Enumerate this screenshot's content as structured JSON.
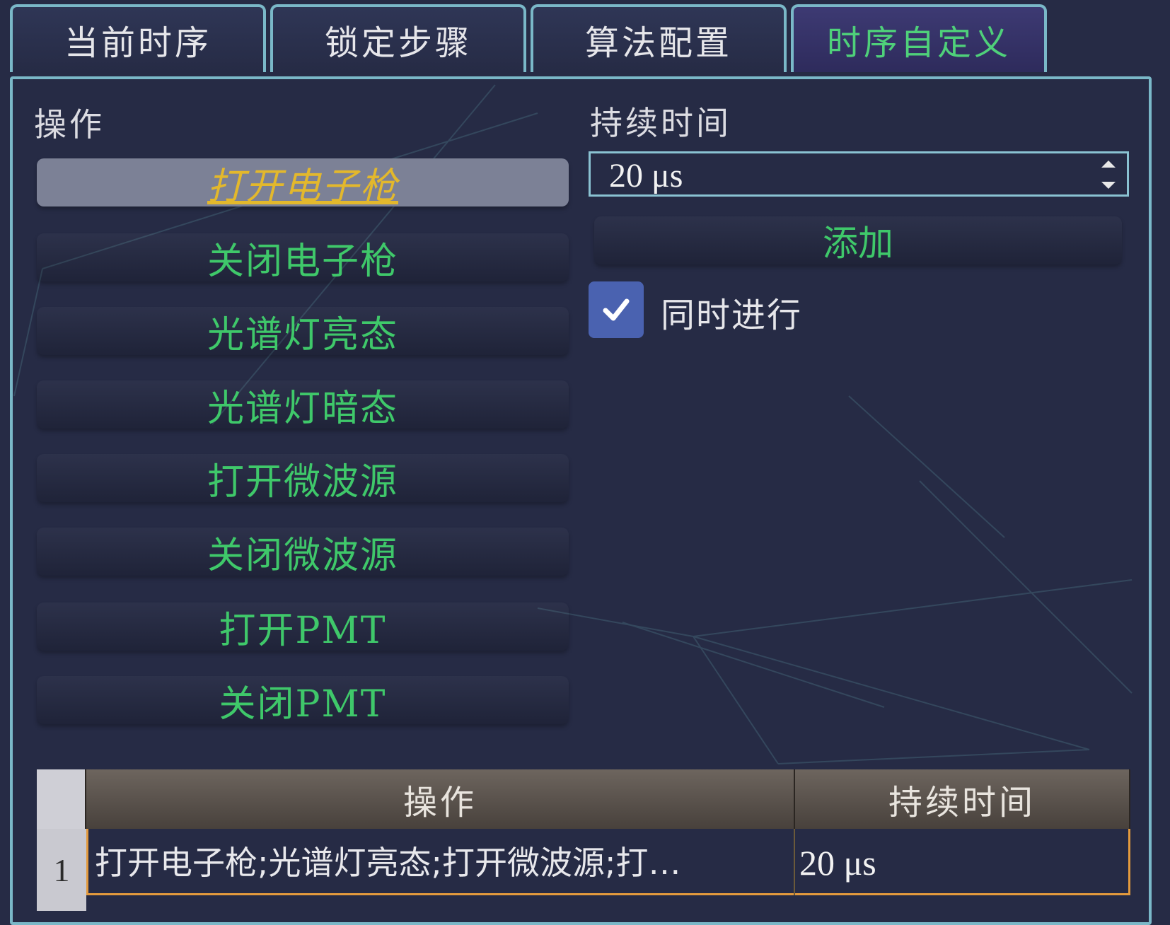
{
  "tabs": [
    {
      "label": "当前时序",
      "active": false
    },
    {
      "label": "锁定步骤",
      "active": false
    },
    {
      "label": "算法配置",
      "active": false
    },
    {
      "label": "时序自定义",
      "active": true
    }
  ],
  "operations": {
    "label": "操作",
    "items": [
      "打开电子枪",
      "关闭电子枪",
      "光谱灯亮态",
      "光谱灯暗态",
      "打开微波源",
      "关闭微波源",
      "打开PMT",
      "关闭PMT"
    ],
    "selected_index": 0
  },
  "duration": {
    "label": "持续时间",
    "value": "20 μs"
  },
  "add_button": {
    "label": "添加"
  },
  "simultaneous": {
    "label": "同时进行",
    "checked": true
  },
  "table": {
    "headers": [
      "操作",
      "持续时间"
    ],
    "rows": [
      {
        "index": "1",
        "operation": "打开电子枪;光谱灯亮态;打开微波源;打…",
        "duration": "20 μs"
      }
    ]
  },
  "colors": {
    "accent_green": "#3fc86a",
    "selected_text": "#e3b82c",
    "border_cyan": "#7ab8c8",
    "row_highlight": "#e39a3d"
  }
}
